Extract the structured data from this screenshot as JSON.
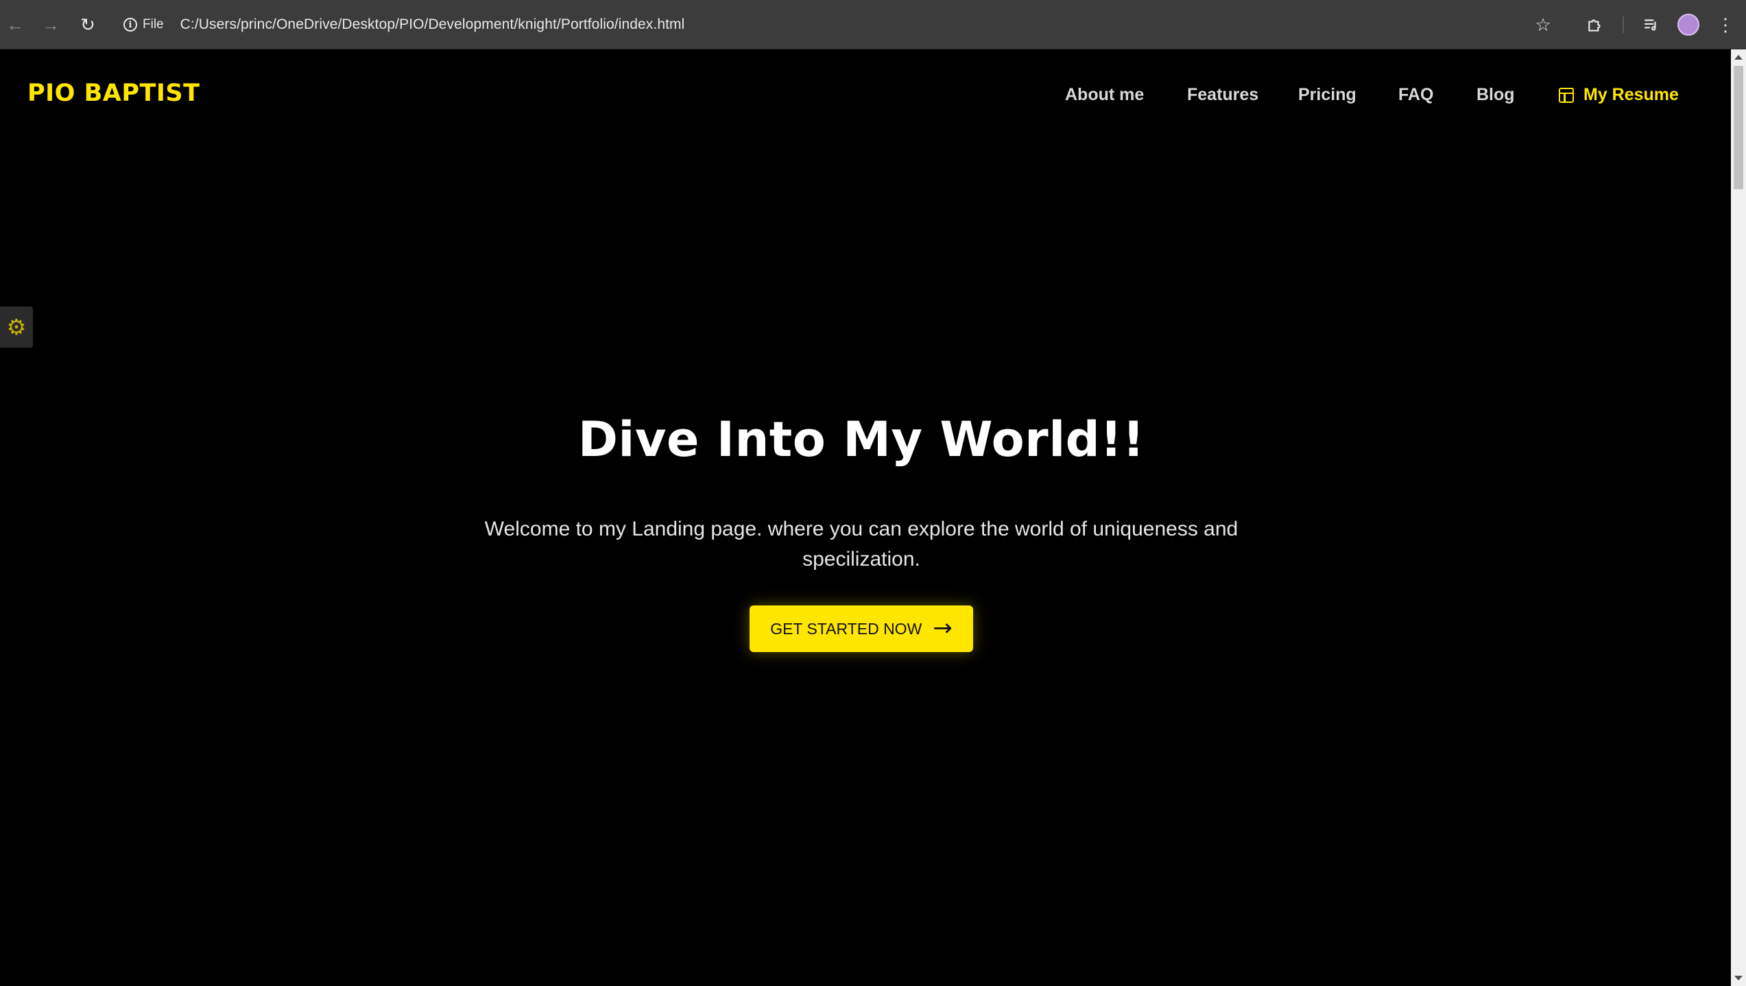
{
  "browser": {
    "site_label": "File",
    "url": "C:/Users/princ/OneDrive/Desktop/PIO/Development/knight/Portfolio/index.html"
  },
  "site": {
    "logo": "PIO BAPTIST",
    "nav": [
      "About me",
      "Features",
      "Pricing",
      "FAQ",
      "Blog"
    ],
    "resume_label": "My Resume"
  },
  "hero": {
    "title": "Dive Into My World!!",
    "subtitle": "Welcome to my Landing page. where you can explore the world of uniqueness and specilization.",
    "cta_label": "GET STARTED NOW"
  },
  "colors": {
    "accent": "#ffe600",
    "background": "#000000"
  },
  "icons": {
    "back": "back-arrow-icon",
    "forward": "forward-arrow-icon",
    "reload": "reload-icon",
    "bookmark": "star-icon",
    "extensions": "puzzle-icon",
    "media": "media-queue-icon",
    "menu": "kebab-menu-icon",
    "settings": "gear-icon",
    "resume": "layout-icon",
    "cta": "arrow-right-icon"
  }
}
